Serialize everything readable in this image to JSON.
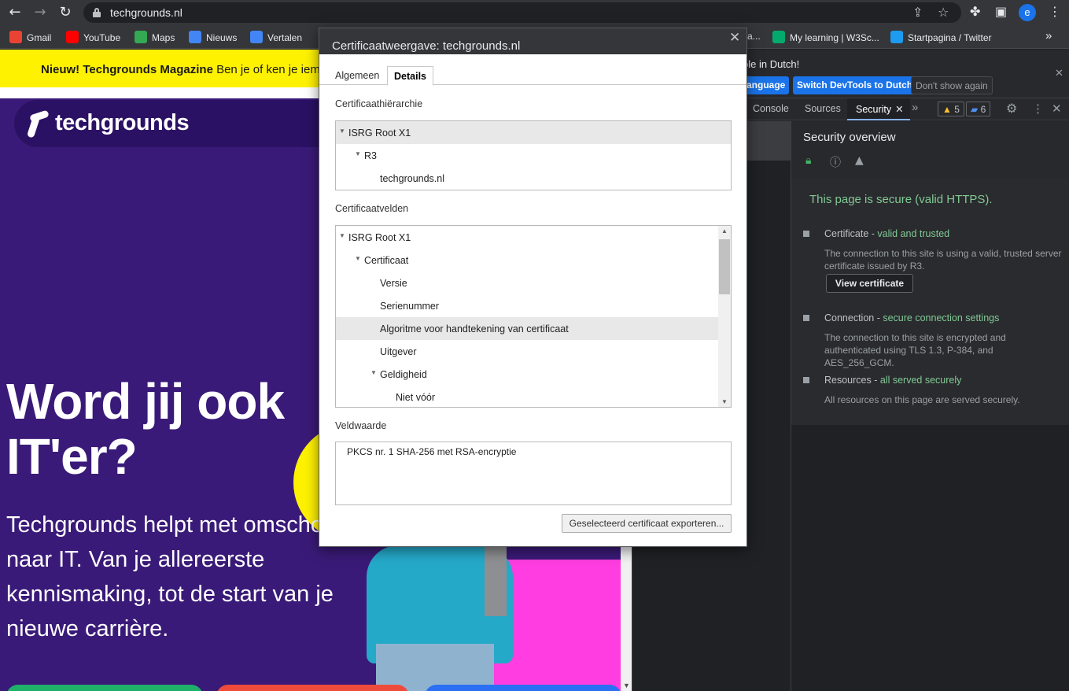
{
  "browser": {
    "url": "techgrounds.nl",
    "profile_initial": "e",
    "bookmarks": [
      {
        "label": "Gmail",
        "color": "#ea4335"
      },
      {
        "label": "YouTube",
        "color": "#ff0000"
      },
      {
        "label": "Maps",
        "color": "#34a853"
      },
      {
        "label": "Nieuws",
        "color": "#4285f4"
      },
      {
        "label": "Vertalen",
        "color": "#4285f4"
      },
      {
        "label": "a...",
        "color": "#35363a"
      },
      {
        "label": "My learning | W3Sc...",
        "color": "#04aa6d"
      },
      {
        "label": "Startpagina / Twitter",
        "color": "#1d9bf0"
      }
    ]
  },
  "page": {
    "banner_bold": "Nieuw! Techgrounds Magazine",
    "banner_rest": " Ben je of ken je ieme",
    "logo_text": "techgrounds",
    "hero_title": "Word jij ook IT'er?",
    "hero_body": "Techgrounds helpt met omscholing naar IT. Van je allereerste kennismaking, tot de start van je nieuwe carrière."
  },
  "devtools": {
    "lang_message": "ble in Dutch!",
    "lang_button_1": "anguage",
    "lang_button_2": "Switch DevTools to Dutch",
    "lang_button_3": "Don't show again",
    "tabs": [
      "Console",
      "Sources",
      "Security"
    ],
    "active_tab": "Security",
    "warnings_count": "5",
    "messages_count": "6",
    "security": {
      "title": "Security overview",
      "secure_message": "This page is secure (valid HTTPS).",
      "items": [
        {
          "title": "Certificate - ",
          "status": "valid and trusted",
          "desc": "The connection to this site is using a valid, trusted server certificate issued by R3.",
          "button": "View certificate"
        },
        {
          "title": "Connection - ",
          "status": "secure connection settings",
          "desc": "The connection to this site is encrypted and authenticated using TLS 1.3, P-384, and AES_256_GCM."
        },
        {
          "title": "Resources - ",
          "status": "all served securely",
          "desc": "All resources on this page are served securely."
        }
      ]
    }
  },
  "dialog": {
    "title": "Certificaatweergave: techgrounds.nl",
    "tab_general": "Algemeen",
    "tab_details": "Details",
    "hierarchy_label": "Certificaathiërarchie",
    "hierarchy": [
      "ISRG Root X1",
      "R3",
      "techgrounds.nl"
    ],
    "fields_label": "Certificaatvelden",
    "fields": [
      "ISRG Root X1",
      "Certificaat",
      "Versie",
      "Serienummer",
      "Algoritme voor handtekening van certificaat",
      "Uitgever",
      "Geldigheid",
      "Niet vóór"
    ],
    "value_label": "Veldwaarde",
    "value": "PKCS nr. 1 SHA-256 met RSA-encryptie",
    "export_button": "Geselecteerd certificaat exporteren..."
  }
}
